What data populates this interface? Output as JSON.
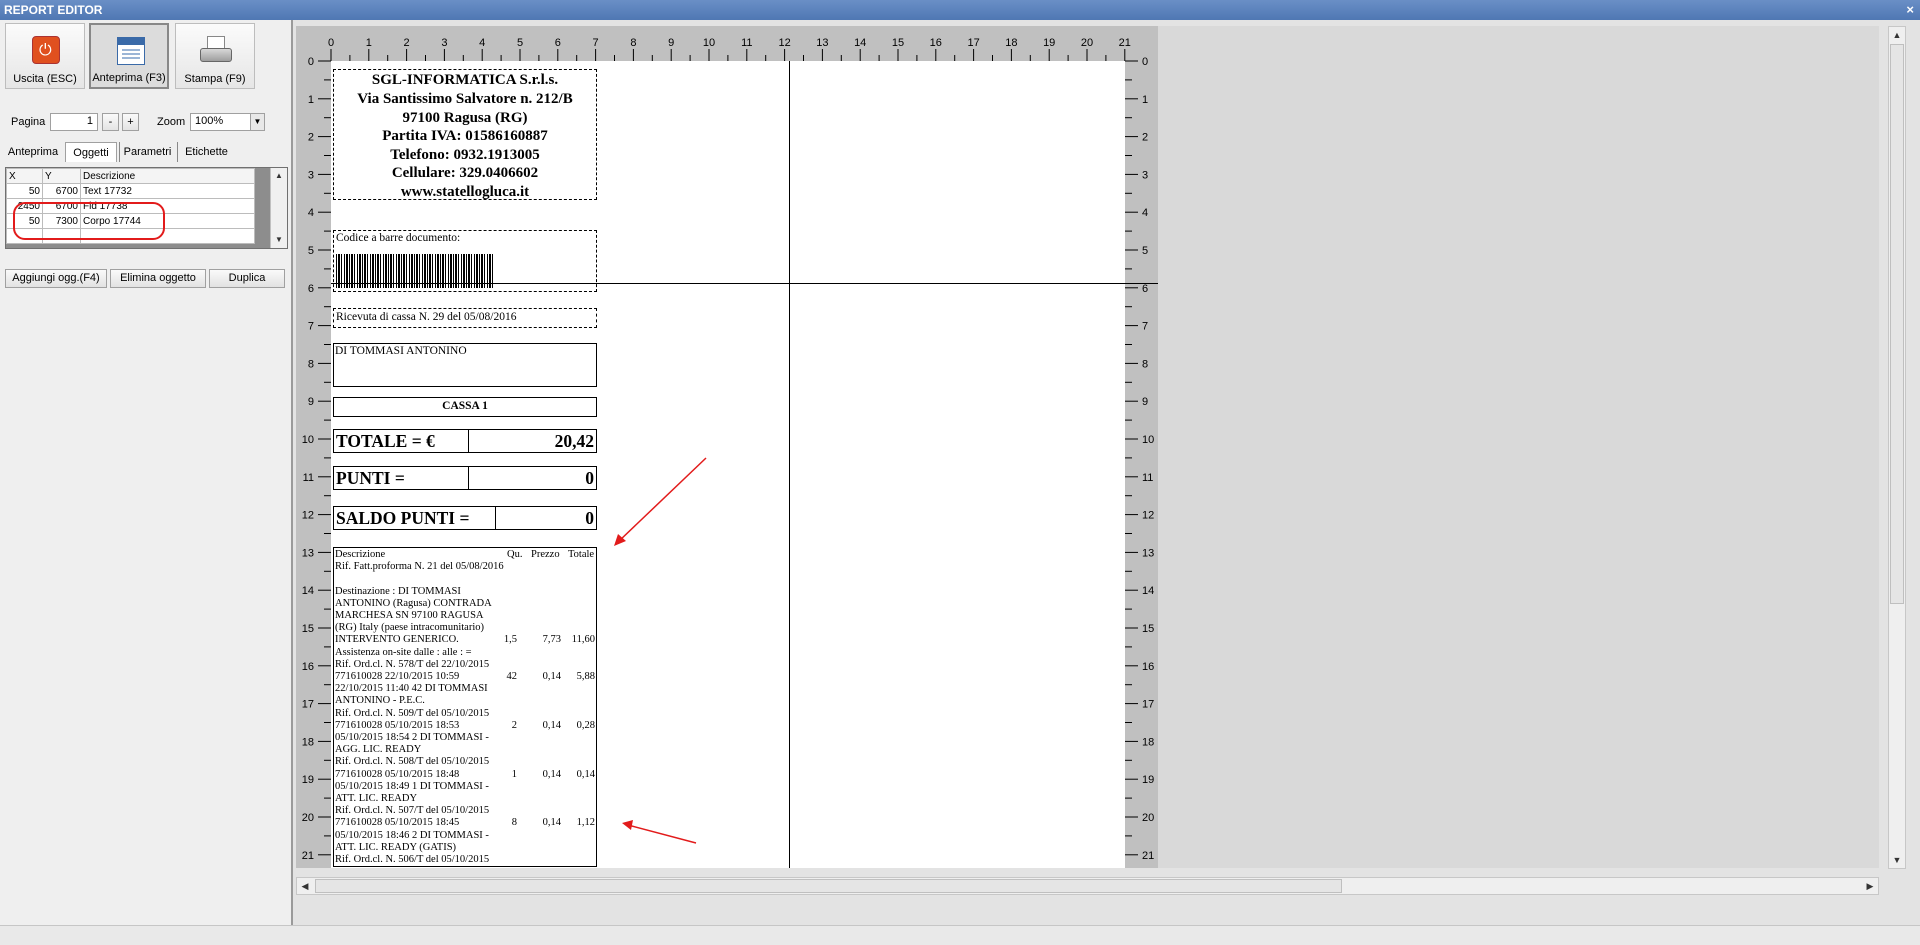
{
  "window": {
    "title": "REPORT EDITOR",
    "close_glyph": "×"
  },
  "toolbar": {
    "exit_label": "Uscita (ESC)",
    "preview_label": "Anteprima (F3)",
    "print_label": "Stampa (F9)"
  },
  "nav": {
    "page_label": "Pagina",
    "page_value": "1",
    "minus_label": "-",
    "plus_label": "+",
    "zoom_label": "Zoom",
    "zoom_value": "100%"
  },
  "tabs": [
    "Anteprima",
    "Oggetti",
    "Parametri",
    "Etichette"
  ],
  "objects_table": {
    "headers": [
      "X",
      "Y",
      "Descrizione"
    ],
    "rows": [
      [
        "50",
        "6700",
        "Text 17732"
      ],
      [
        "2450",
        "6700",
        "Fld 17738"
      ],
      [
        "50",
        "7300",
        "Corpo 17744"
      ]
    ]
  },
  "actions": {
    "add_label": "Aggiungi ogg.(F4)",
    "delete_label": "Elimina oggetto",
    "duplicate_label": "Duplica"
  },
  "ruler": {
    "top_numbers": [
      "0",
      "1",
      "2",
      "3",
      "4",
      "5",
      "6",
      "7",
      "8",
      "9",
      "10",
      "11",
      "12",
      "13",
      "14",
      "15",
      "16",
      "17",
      "18",
      "19",
      "20",
      "21"
    ],
    "side_numbers": [
      "0",
      "1",
      "2",
      "3",
      "4",
      "5",
      "6",
      "7",
      "8",
      "9",
      "10",
      "11",
      "12",
      "13",
      "14",
      "15",
      "16",
      "17",
      "18",
      "19",
      "20",
      "21"
    ]
  },
  "receipt": {
    "header_lines": [
      "SGL-INFORMATICA S.r.l.s.",
      "Via Santissimo Salvatore n. 212/B",
      "97100 Ragusa (RG)",
      "Partita IVA: 01586160887",
      "Telefono: 0932.1913005",
      "Cellulare: 329.0406602",
      "www.statellogluca.it"
    ],
    "barcode_label": "Codice a barre documento:",
    "receipt_no": "Ricevuta di cassa N. 29 del 05/08/2016",
    "customer": "DI TOMMASI ANTONINO",
    "cassa": "CASSA 1",
    "totale_label": "TOTALE = €",
    "totale_value": "20,42",
    "punti_label": "PUNTI =",
    "punti_value": "0",
    "saldo_label": "SALDO PUNTI =",
    "saldo_value": "0",
    "items_headers": [
      "Descrizione",
      "Qu.",
      "Prezzo",
      "Totale"
    ],
    "items_text": [
      {
        "d": "Rif. Fatt.proforma N. 21 del 05/08/2016",
        "q": "",
        "p": "",
        "t": ""
      },
      {
        "d": "Destinazione : DI TOMMASI ANTONINO (Ragusa) CONTRADA MARCHESA SN 97100 RAGUSA (RG) Italy (paese intracomunitario)",
        "q": "",
        "p": "",
        "t": ""
      },
      {
        "d": "INTERVENTO GENERICO.",
        "q": "1,5",
        "p": "7,73",
        "t": "11,60"
      },
      {
        "d": "Assistenza on-site dalle : alle : =",
        "q": "",
        "p": "",
        "t": ""
      },
      {
        "d": "Rif. Ord.cl. N. 578/T del 22/10/2015",
        "q": "",
        "p": "",
        "t": ""
      },
      {
        "d": "771610028 22/10/2015 10:59",
        "q": "42",
        "p": "0,14",
        "t": "5,88"
      },
      {
        "d": "22/10/2015 11:40 42 DI TOMMASI ANTONINO - P.E.C.",
        "q": "",
        "p": "",
        "t": ""
      },
      {
        "d": "Rif. Ord.cl. N. 509/T del 05/10/2015",
        "q": "",
        "p": "",
        "t": ""
      },
      {
        "d": "771610028 05/10/2015 18:53",
        "q": "2",
        "p": "0,14",
        "t": "0,28"
      },
      {
        "d": "05/10/2015 18:54 2 DI TOMMASI - AGG. LIC. READY",
        "q": "",
        "p": "",
        "t": ""
      },
      {
        "d": "Rif. Ord.cl. N. 508/T del 05/10/2015",
        "q": "",
        "p": "",
        "t": ""
      },
      {
        "d": "771610028 05/10/2015 18:48",
        "q": "1",
        "p": "0,14",
        "t": "0,14"
      },
      {
        "d": "05/10/2015 18:49 1 DI TOMMASI - ATT. LIC. READY",
        "q": "",
        "p": "",
        "t": ""
      },
      {
        "d": "Rif. Ord.cl. N. 507/T del 05/10/2015",
        "q": "",
        "p": "",
        "t": ""
      },
      {
        "d": "771610028 05/10/2015 18:45",
        "q": "8",
        "p": "0,14",
        "t": "1,12"
      },
      {
        "d": "05/10/2015 18:46 2 DI TOMMASI - ATT. LIC. READY (GATIS)",
        "q": "",
        "p": "",
        "t": ""
      },
      {
        "d": "Rif. Ord.cl. N. 506/T del 05/10/2015",
        "q": "",
        "p": "",
        "t": ""
      }
    ]
  },
  "colors": {
    "annotation": "#e21b1b",
    "titlebar": "#5a80ba"
  }
}
